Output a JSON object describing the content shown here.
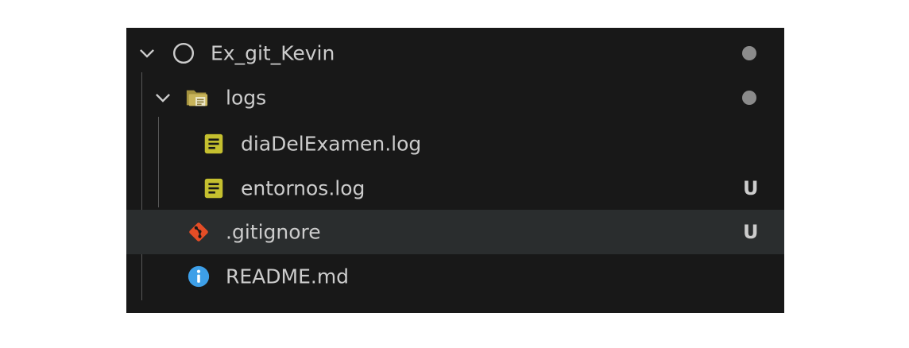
{
  "explorer": {
    "root": {
      "label": "Ex_git_Kevin",
      "icon": "circle-outline-icon",
      "expanded": true,
      "modified": true
    },
    "items": [
      {
        "label": "logs",
        "type": "folder",
        "icon": "folder-icon",
        "expanded": true,
        "modified": true,
        "status": ""
      },
      {
        "label": "diaDelExamen.log",
        "type": "file",
        "icon": "log-file-icon",
        "status": ""
      },
      {
        "label": "entornos.log",
        "type": "file",
        "icon": "log-file-icon",
        "status": "U"
      },
      {
        "label": ".gitignore",
        "type": "file",
        "icon": "git-icon",
        "status": "U",
        "selected": true
      },
      {
        "label": "README.md",
        "type": "file",
        "icon": "info-icon",
        "status": ""
      }
    ]
  },
  "colors": {
    "panel_bg": "#181818",
    "selected_bg": "#2a2d2e",
    "text": "#cccccc",
    "log_icon": "#c5c02f",
    "git_icon": "#e44d26",
    "info_icon": "#3d9fe8",
    "folder_icon": "#c8b45a"
  }
}
